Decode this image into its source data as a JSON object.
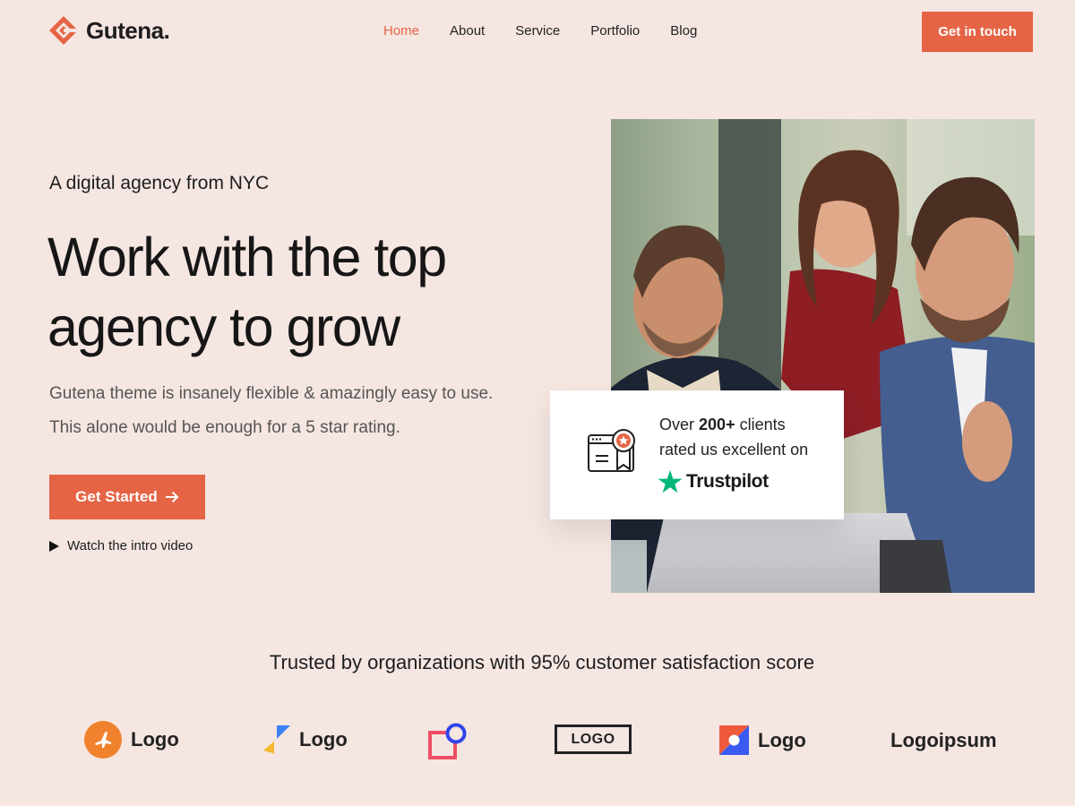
{
  "brand": {
    "name": "Gutena."
  },
  "nav": {
    "items": [
      {
        "label": "Home",
        "active": true
      },
      {
        "label": "About",
        "active": false
      },
      {
        "label": "Service",
        "active": false
      },
      {
        "label": "Portfolio",
        "active": false
      },
      {
        "label": "Blog",
        "active": false
      }
    ],
    "cta_label": "Get in touch"
  },
  "hero": {
    "eyebrow": "A digital agency from NYC",
    "headline_line1": "Work with the top",
    "headline_line2": "agency to grow",
    "subtext": "Gutena theme is insanely flexible & amazingly easy to use. This alone would be enough for a 5 star rating.",
    "primary_button": "Get Started",
    "video_link": "Watch the intro video"
  },
  "rating_card": {
    "prefix": "Over",
    "count": "200+",
    "suffix": "clients",
    "line2": "rated us excellent on",
    "brand": "Trustpilot"
  },
  "trusted": {
    "title": "Trusted by organizations with 95% customer satisfaction score",
    "logos": [
      {
        "label": "Logo",
        "icon": "plane-circle-icon"
      },
      {
        "label": "Logo",
        "icon": "flag-shape-icon"
      },
      {
        "label": "",
        "icon": "square-circle-icon"
      },
      {
        "label": "LOGO",
        "icon": "boxed-wordmark"
      },
      {
        "label": "Logo",
        "icon": "split-square-icon"
      },
      {
        "label": "Logoipsum",
        "icon": "wordmark"
      }
    ]
  },
  "colors": {
    "background": "#f5e6e2",
    "accent": "#e56445",
    "text": "#1d1d1f",
    "trustpilot_green": "#00b67a"
  }
}
